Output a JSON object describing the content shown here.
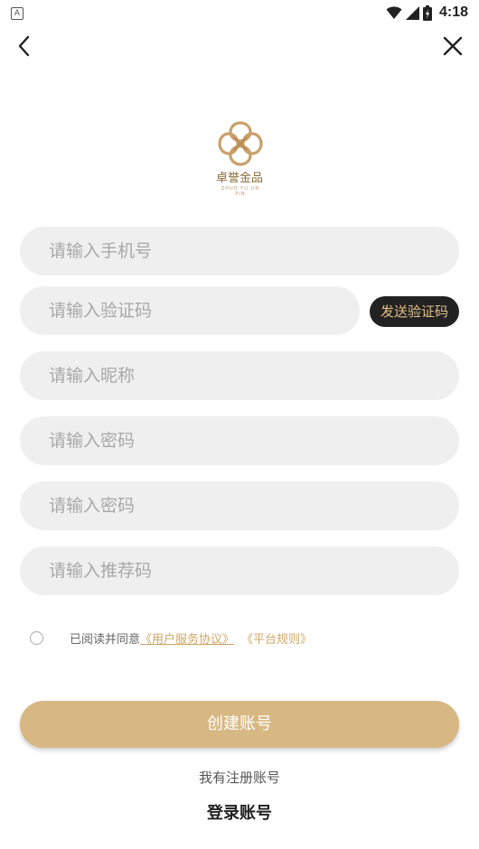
{
  "status_bar": {
    "app_icon_label": "A",
    "time": "4:18",
    "icons": [
      "wifi-icon",
      "cell-signal-icon",
      "battery-charging-icon"
    ]
  },
  "nav": {
    "back_icon": "chevron-left-icon",
    "close_icon": "close-icon"
  },
  "logo": {
    "name": "卓誉金品",
    "subtitle": "ZHUO YU JIN PIN",
    "color": "#c9a06a"
  },
  "form": {
    "phone_placeholder": "请输入手机号",
    "code_placeholder": "请输入验证码",
    "send_code_label": "发送验证码",
    "nickname_placeholder": "请输入昵称",
    "password_placeholder": "请输入密码",
    "confirm_password_placeholder": "请输入密码",
    "referral_placeholder": "请输入推荐码"
  },
  "agreement": {
    "checked": false,
    "prefix": "已阅读并同意",
    "user_agreement": "《用户服务协议》",
    "platform_rules": "《平台规则》",
    "link_color": "#d0a766"
  },
  "actions": {
    "create_account": "创建账号",
    "have_account": "我有注册账号",
    "login": "登录账号"
  },
  "colors": {
    "accent": "#d7b883",
    "send_button_bg": "#222222",
    "send_button_text": "#e2bf86",
    "field_bg": "#efefef"
  }
}
